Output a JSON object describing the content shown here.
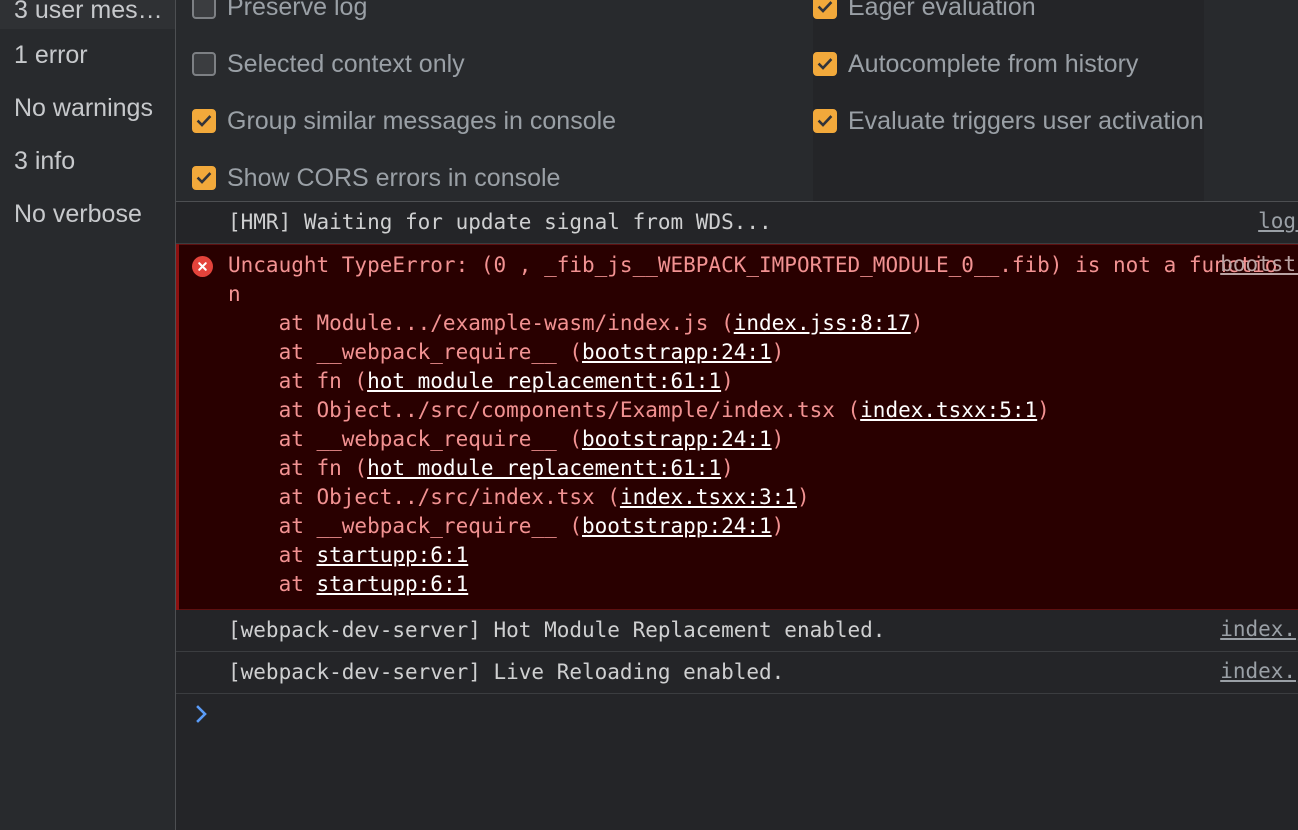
{
  "sidebar": {
    "items": [
      {
        "label": "3 user mes…",
        "name": "sidebar-item-user-messages"
      },
      {
        "label": "1 error",
        "name": "sidebar-item-errors"
      },
      {
        "label": "No warnings",
        "name": "sidebar-item-warnings"
      },
      {
        "label": "3 info",
        "name": "sidebar-item-info"
      },
      {
        "label": "No verbose",
        "name": "sidebar-item-verbose"
      }
    ]
  },
  "settings": {
    "left_column": [
      {
        "label": "Preserve log",
        "checked": false
      },
      {
        "label": "Selected context only",
        "checked": false
      },
      {
        "label": "Group similar messages in console",
        "checked": true
      },
      {
        "label": "Show CORS errors in console",
        "checked": true
      }
    ],
    "right_column": [
      {
        "label": "Eager evaluation",
        "checked": true
      },
      {
        "label": "Autocomplete from history",
        "checked": true
      },
      {
        "label": "Evaluate triggers user activation",
        "checked": true
      }
    ]
  },
  "console": {
    "messages": [
      {
        "level": "info",
        "text": "[HMR] Waiting for update signal from WDS...",
        "source": "log.js"
      },
      {
        "level": "error",
        "text": "Uncaught TypeError: (0 , _fib_js__WEBPACK_IMPORTED_MODULE_0__.fib) is not a function",
        "source": "bootstrap",
        "stack": [
          {
            "prefix": "    at Module.../example-wasm/index.js (",
            "link": "index.jss:8:17",
            "suffix": ")"
          },
          {
            "prefix": "    at __webpack_require__ (",
            "link": "bootstrapp:24:1",
            "suffix": ")"
          },
          {
            "prefix": "    at fn (",
            "link": "hot module replacementt:61:1",
            "suffix": ")"
          },
          {
            "prefix": "    at Object../src/components/Example/index.tsx (",
            "link": "index.tsxx:5:1",
            "suffix": ")"
          },
          {
            "prefix": "    at __webpack_require__ (",
            "link": "bootstrapp:24:1",
            "suffix": ")"
          },
          {
            "prefix": "    at fn (",
            "link": "hot module replacementt:61:1",
            "suffix": ")"
          },
          {
            "prefix": "    at Object../src/index.tsx (",
            "link": "index.tsxx:3:1",
            "suffix": ")"
          },
          {
            "prefix": "    at __webpack_require__ (",
            "link": "bootstrapp:24:1",
            "suffix": ")"
          },
          {
            "prefix": "    at ",
            "link": "startupp:6:1",
            "suffix": ""
          },
          {
            "prefix": "    at ",
            "link": "startupp:6:1",
            "suffix": ""
          }
        ]
      },
      {
        "level": "info",
        "text": "[webpack-dev-server] Hot Module Replacement enabled.",
        "source": "index.jss"
      },
      {
        "level": "info",
        "text": "[webpack-dev-server] Live Reloading enabled.",
        "source": "index.jss"
      }
    ],
    "prompt": {
      "arrow": "chevron-right-icon",
      "value": ""
    }
  },
  "colors": {
    "accent_checkbox": "#f2a93b",
    "error_text": "#f29292",
    "error_bg": "#290000",
    "error_icon": "#e4433b",
    "panel_bg": "#282a2d",
    "console_bg": "#242528",
    "label_text": "#9aa0a6",
    "prompt_arrow": "#5a9cf8"
  }
}
